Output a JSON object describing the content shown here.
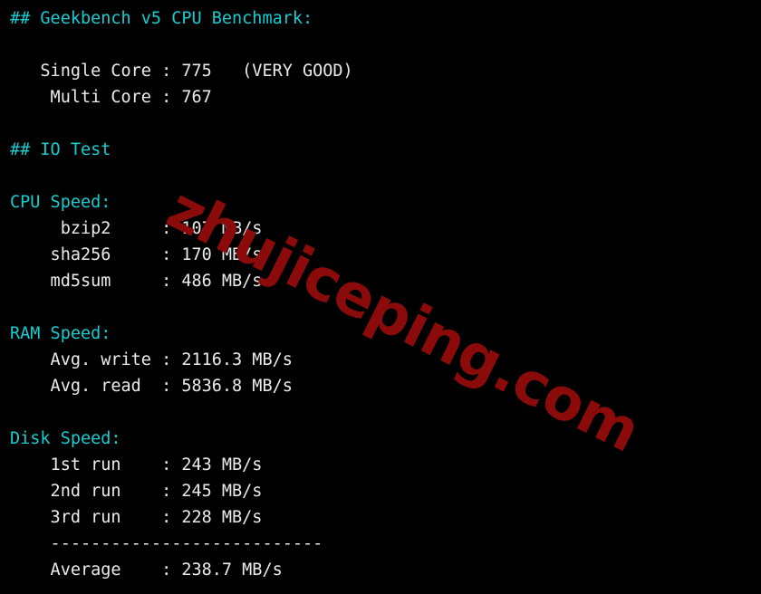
{
  "terminal": {
    "background_color": "#000000",
    "default_text_color": "#ebebeb",
    "heading_color": "#16cdd1",
    "watermark_color": "#8b0b0b",
    "watermark_text": "zhujiceping.com"
  },
  "sections": {
    "geekbench": {
      "heading": "## Geekbench v5 CPU Benchmark:",
      "rows": [
        {
          "label": "  Single Core",
          "sep": ":",
          "value": "775",
          "note": "(VERY GOOD)"
        },
        {
          "label": "   Multi Core",
          "sep": ":",
          "value": "767",
          "note": ""
        }
      ],
      "line_single": "   Single Core : 775   (VERY GOOD)",
      "line_multi": "    Multi Core : 767"
    },
    "io_test": {
      "heading": "## IO Test"
    },
    "cpu_speed": {
      "heading": "CPU Speed:",
      "rows": [
        {
          "label": "bzip2",
          "value": "107",
          "unit": "MB/s"
        },
        {
          "label": "sha256",
          "value": "170",
          "unit": "MB/s"
        },
        {
          "label": "md5sum",
          "value": "486",
          "unit": "MB/s"
        }
      ],
      "line_bzip2": "     bzip2     : 107 MB/s",
      "line_sha256": "    sha256     : 170 MB/s",
      "line_md5sum": "    md5sum     : 486 MB/s"
    },
    "ram_speed": {
      "heading": "RAM Speed:",
      "rows": [
        {
          "label": "Avg. write",
          "value": "2116.3",
          "unit": "MB/s"
        },
        {
          "label": "Avg. read",
          "value": "5836.8",
          "unit": "MB/s"
        }
      ],
      "line_write": "    Avg. write : 2116.3 MB/s",
      "line_read": "    Avg. read  : 5836.8 MB/s"
    },
    "disk_speed": {
      "heading": "Disk Speed:",
      "rows": [
        {
          "label": "1st run",
          "value": "243",
          "unit": "MB/s"
        },
        {
          "label": "2nd run",
          "value": "245",
          "unit": "MB/s"
        },
        {
          "label": "3rd run",
          "value": "228",
          "unit": "MB/s"
        },
        {
          "label": "Average",
          "value": "238.7",
          "unit": "MB/s"
        }
      ],
      "line_run1": "    1st run    : 243 MB/s",
      "line_run2": "    2nd run    : 245 MB/s",
      "line_run3": "    3rd run    : 228 MB/s",
      "separator": "    ---------------------------",
      "line_avg": "    Average    : 238.7 MB/s"
    }
  }
}
